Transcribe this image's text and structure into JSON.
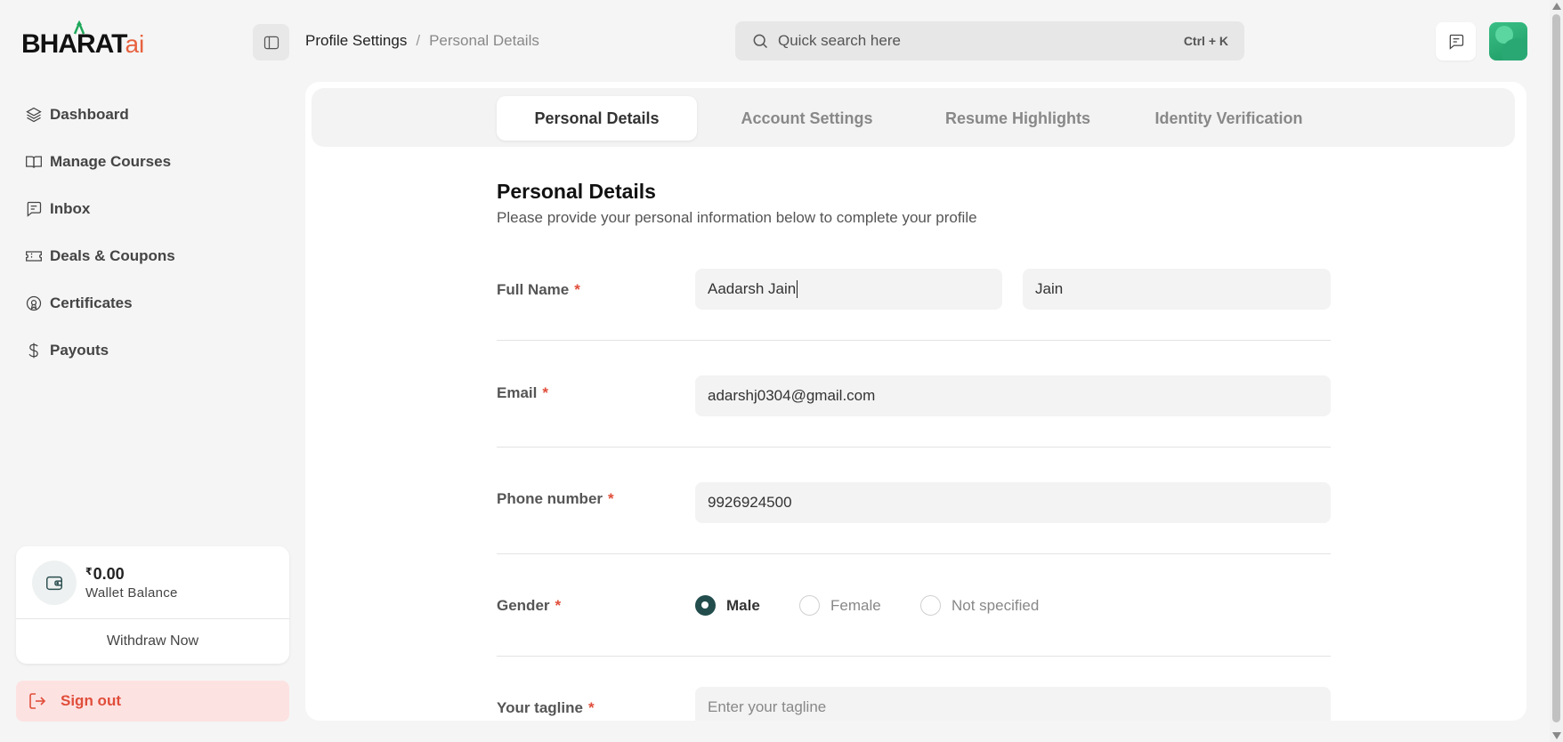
{
  "logo": {
    "main": "BHARAT",
    "ai": "ai"
  },
  "sidebar": {
    "items": [
      {
        "label": "Dashboard",
        "icon": "layers-icon"
      },
      {
        "label": "Manage Courses",
        "icon": "book-icon"
      },
      {
        "label": "Inbox",
        "icon": "message-icon"
      },
      {
        "label": "Deals & Coupons",
        "icon": "ticket-icon"
      },
      {
        "label": "Certificates",
        "icon": "certificate-icon"
      },
      {
        "label": "Payouts",
        "icon": "dollar-icon"
      }
    ],
    "wallet": {
      "currency": "₹",
      "amount": "0.00",
      "label": "Wallet Balance",
      "withdraw_label": "Withdraw Now"
    },
    "signout_label": "Sign out"
  },
  "header": {
    "breadcrumb": {
      "parent": "Profile Settings",
      "separator": "/",
      "current": "Personal Details"
    },
    "search": {
      "placeholder": "Quick search here",
      "shortcut": "Ctrl + K"
    }
  },
  "tabs": [
    {
      "label": "Personal Details",
      "active": true
    },
    {
      "label": "Account Settings",
      "active": false
    },
    {
      "label": "Resume Highlights",
      "active": false
    },
    {
      "label": "Identity Verification",
      "active": false
    }
  ],
  "form": {
    "title": "Personal Details",
    "subtitle": "Please provide your personal information below to complete your profile",
    "required_mark": "*",
    "full_name": {
      "label": "Full Name",
      "first": "Aadarsh Jain",
      "last": "Jain"
    },
    "email": {
      "label": "Email",
      "value": "adarshj0304@gmail.com"
    },
    "phone": {
      "label": "Phone number",
      "value": "9926924500"
    },
    "gender": {
      "label": "Gender",
      "options": [
        "Male",
        "Female",
        "Not specified"
      ],
      "selected": "Male"
    },
    "tagline": {
      "label": "Your tagline",
      "placeholder": "Enter your tagline"
    }
  },
  "colors": {
    "accent": "#e04e3a",
    "radio_checked": "#234d4d",
    "avatar": "#2aa874"
  }
}
